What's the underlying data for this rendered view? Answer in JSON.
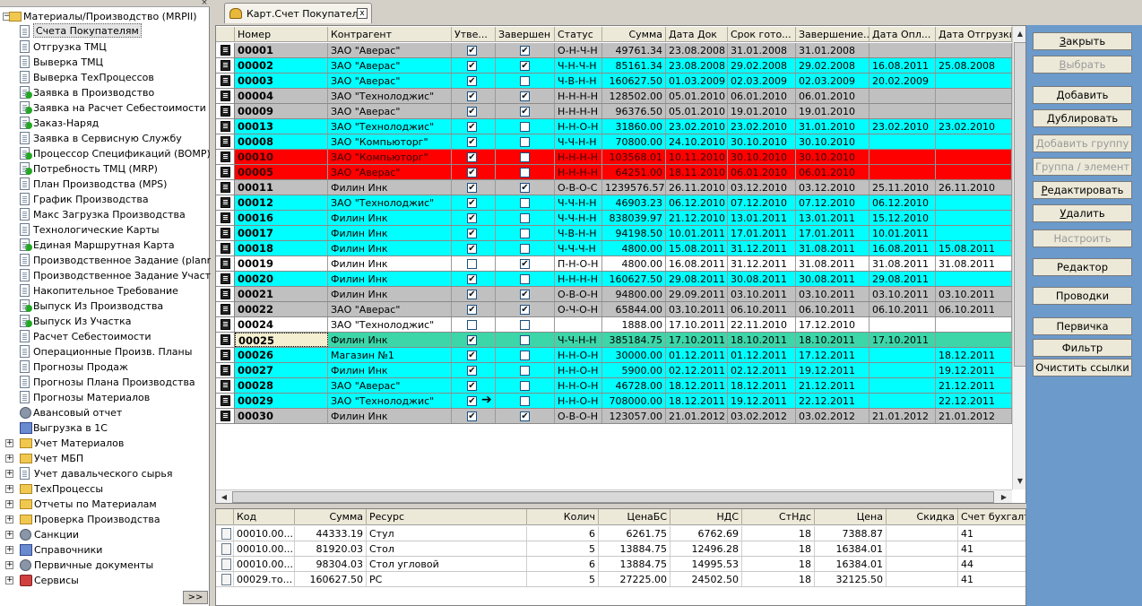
{
  "tree": {
    "root_label": "Материалы/Производство (MRPII)",
    "items": [
      {
        "label": "Счета Покупателям",
        "icon": "document-arrow-icon"
      },
      {
        "label": "Отгрузка ТМЦ",
        "icon": "document-arrow-icon"
      },
      {
        "label": "Выверка ТМЦ",
        "icon": "document-icon"
      },
      {
        "label": "Выверка ТехПроцессов",
        "icon": "document-icon"
      },
      {
        "label": "Заявка в Производство",
        "icon": "document-plus-icon"
      },
      {
        "label": "Заявка на Расчет Себестоимости",
        "icon": "document-plus-icon"
      },
      {
        "label": "Заказ-Наряд",
        "icon": "document-plus-icon"
      },
      {
        "label": "Заявка в Сервисную Службу",
        "icon": "document-arrow-icon"
      },
      {
        "label": "Процессор Спецификаций (BOMP)",
        "icon": "document-plus-icon"
      },
      {
        "label": "Потребность ТМЦ (MRP)",
        "icon": "document-plus-icon"
      },
      {
        "label": "План Производства (MPS)",
        "icon": "document-icon"
      },
      {
        "label": "График Производства",
        "icon": "document-arrow-icon"
      },
      {
        "label": "Макс Загрузка Производства",
        "icon": "document-arrow-icon"
      },
      {
        "label": "Технологические Карты",
        "icon": "document-arrow-icon"
      },
      {
        "label": "Единая Маршрутная Карта",
        "icon": "document-plus-icon"
      },
      {
        "label": "Производственное Задание (planne...",
        "icon": "document-arrow-icon"
      },
      {
        "label": "Производственное Задание Участка",
        "icon": "document-arrow-icon"
      },
      {
        "label": "Накопительное Требование",
        "icon": "document-arrow-icon"
      },
      {
        "label": "Выпуск Из Производства",
        "icon": "document-plus-icon"
      },
      {
        "label": "Выпуск Из Участка",
        "icon": "document-plus-icon"
      },
      {
        "label": "Расчет Себестоимости",
        "icon": "document-arrow-icon"
      },
      {
        "label": "Операционные Произв. Планы",
        "icon": "document-icon"
      },
      {
        "label": "Прогнозы Продаж",
        "icon": "document-arrow-icon"
      },
      {
        "label": "Прогнозы Плана Производства",
        "icon": "document-icon"
      },
      {
        "label": "Прогнозы Материалов",
        "icon": "document-arrow-icon"
      },
      {
        "label": "Авансовый отчет",
        "icon": "ledger-icon"
      },
      {
        "label": "Выгрузка в 1С",
        "icon": "export-icon"
      }
    ],
    "groups": [
      {
        "label": "Учет Материалов",
        "icon": "folder-icon"
      },
      {
        "label": "Учет МБП",
        "icon": "folder-icon"
      },
      {
        "label": "Учет давальческого сырья",
        "icon": "document-icon"
      },
      {
        "label": "ТехПроцессы",
        "icon": "folder-icon"
      },
      {
        "label": "Отчеты по Материалам",
        "icon": "folder-icon"
      },
      {
        "label": "Проверка Производства",
        "icon": "folder-icon"
      },
      {
        "label": "Санкции",
        "icon": "gear-icon"
      },
      {
        "label": "Справочники",
        "icon": "cube-icon"
      },
      {
        "label": "Первичные документы",
        "icon": "gear-icon"
      },
      {
        "label": "Сервисы",
        "icon": "tools-icon"
      }
    ],
    "more_label": ">>"
  },
  "tab": {
    "title": "Карт.Счет Покупателю",
    "close": "x"
  },
  "grid": {
    "columns": [
      "Номер",
      "Контрагент",
      "Утве...",
      "Завершен",
      "Статус",
      "Сумма",
      "Дата Док",
      "Срок гото...",
      "Завершение...",
      "Дата Опл...",
      "Дата Отгрузки"
    ],
    "rows": [
      {
        "num": "00001",
        "agent": "ЗАО \"Аверас\"",
        "appr": true,
        "done": true,
        "status": "О-Н-Ч-Н",
        "sum": "49761.34",
        "date": "23.08.2008",
        "term": "31.01.2008",
        "fin": "31.01.2008",
        "pay": "",
        "ship": "",
        "color": "#c0c0c0"
      },
      {
        "num": "00002",
        "agent": "ЗАО \"Аверас\"",
        "appr": true,
        "done": true,
        "status": "Ч-Н-Ч-Н",
        "sum": "85161.34",
        "date": "23.08.2008",
        "term": "29.02.2008",
        "fin": "29.02.2008",
        "pay": "16.08.2011",
        "ship": "25.08.2008",
        "color": "#00ffff"
      },
      {
        "num": "00003",
        "agent": "ЗАО \"Аверас\"",
        "appr": true,
        "done": false,
        "status": "Ч-В-Н-Н",
        "sum": "160627.50",
        "date": "01.03.2009",
        "term": "02.03.2009",
        "fin": "02.03.2009",
        "pay": "20.02.2009",
        "ship": "",
        "color": "#00ffff"
      },
      {
        "num": "00004",
        "agent": "ЗАО \"Технолоджис\"",
        "appr": true,
        "done": true,
        "status": "Н-Н-Н-Н",
        "sum": "128502.00",
        "date": "05.01.2010",
        "term": "06.01.2010",
        "fin": "06.01.2010",
        "pay": "",
        "ship": "",
        "color": "#c0c0c0"
      },
      {
        "num": "00009",
        "agent": "ЗАО \"Аверас\"",
        "appr": true,
        "done": true,
        "status": "Н-Н-Н-Н",
        "sum": "96376.50",
        "date": "05.01.2010",
        "term": "19.01.2010",
        "fin": "19.01.2010",
        "pay": "",
        "ship": "",
        "color": "#c0c0c0"
      },
      {
        "num": "00013",
        "agent": "ЗАО \"Технолоджис\"",
        "appr": true,
        "done": false,
        "status": "Н-Н-О-Н",
        "sum": "31860.00",
        "date": "23.02.2010",
        "term": "23.02.2010",
        "fin": "31.01.2010",
        "pay": "23.02.2010",
        "ship": "23.02.2010",
        "color": "#00ffff"
      },
      {
        "num": "00008",
        "agent": "ЗАО \"Компьюторг\"",
        "appr": true,
        "done": false,
        "status": "Ч-Ч-Н-Н",
        "sum": "70800.00",
        "date": "24.10.2010",
        "term": "30.10.2010",
        "fin": "30.10.2010",
        "pay": "",
        "ship": "",
        "color": "#00ffff"
      },
      {
        "num": "00010",
        "agent": "ЗАО \"Компьюторг\"",
        "appr": true,
        "done": false,
        "status": "Н-Н-Н-Н",
        "sum": "103568.01",
        "date": "10.11.2010",
        "term": "30.10.2010",
        "fin": "30.10.2010",
        "pay": "",
        "ship": "",
        "color": "#ff0000"
      },
      {
        "num": "00005",
        "agent": "ЗАО \"Аверас\"",
        "appr": true,
        "done": false,
        "status": "Н-Н-Н-Н",
        "sum": "64251.00",
        "date": "18.11.2010",
        "term": "06.01.2010",
        "fin": "06.01.2010",
        "pay": "",
        "ship": "",
        "color": "#ff0000"
      },
      {
        "num": "00011",
        "agent": "Филин Инк",
        "appr": true,
        "done": true,
        "status": "О-В-О-С",
        "sum": "1239576.57",
        "date": "26.11.2010",
        "term": "03.12.2010",
        "fin": "03.12.2010",
        "pay": "25.11.2010",
        "ship": "26.11.2010",
        "color": "#c0c0c0"
      },
      {
        "num": "00012",
        "agent": "ЗАО \"Технолоджис\"",
        "appr": true,
        "done": false,
        "status": "Ч-Ч-Н-Н",
        "sum": "46903.23",
        "date": "06.12.2010",
        "term": "07.12.2010",
        "fin": "07.12.2010",
        "pay": "06.12.2010",
        "ship": "",
        "color": "#00ffff"
      },
      {
        "num": "00016",
        "agent": "Филин Инк",
        "appr": true,
        "done": false,
        "status": "Ч-Ч-Н-Н",
        "sum": "838039.97",
        "date": "21.12.2010",
        "term": "13.01.2011",
        "fin": "13.01.2011",
        "pay": "15.12.2010",
        "ship": "",
        "color": "#00ffff"
      },
      {
        "num": "00017",
        "agent": "Филин Инк",
        "appr": true,
        "done": false,
        "status": "Ч-В-Н-Н",
        "sum": "94198.50",
        "date": "10.01.2011",
        "term": "17.01.2011",
        "fin": "17.01.2011",
        "pay": "10.01.2011",
        "ship": "",
        "color": "#00ffff"
      },
      {
        "num": "00018",
        "agent": "Филин Инк",
        "appr": true,
        "done": false,
        "status": "Ч-Ч-Ч-Н",
        "sum": "4800.00",
        "date": "15.08.2011",
        "term": "31.12.2011",
        "fin": "31.08.2011",
        "pay": "16.08.2011",
        "ship": "15.08.2011",
        "color": "#00ffff"
      },
      {
        "num": "00019",
        "agent": "Филин Инк",
        "appr": false,
        "done": true,
        "status": "П-Н-О-Н",
        "sum": "4800.00",
        "date": "16.08.2011",
        "term": "31.12.2011",
        "fin": "31.08.2011",
        "pay": "31.08.2011",
        "ship": "31.08.2011",
        "color": "#ffffff"
      },
      {
        "num": "00020",
        "agent": "Филин Инк",
        "appr": true,
        "done": false,
        "status": "Н-Н-Н-Н",
        "sum": "160627.50",
        "date": "29.08.2011",
        "term": "30.08.2011",
        "fin": "30.08.2011",
        "pay": "29.08.2011",
        "ship": "",
        "color": "#00ffff"
      },
      {
        "num": "00021",
        "agent": "Филин Инк",
        "appr": true,
        "done": true,
        "status": "О-В-О-Н",
        "sum": "94800.00",
        "date": "29.09.2011",
        "term": "03.10.2011",
        "fin": "03.10.2011",
        "pay": "03.10.2011",
        "ship": "03.10.2011",
        "color": "#c0c0c0"
      },
      {
        "num": "00022",
        "agent": "ЗАО \"Аверас\"",
        "appr": true,
        "done": true,
        "status": "О-Ч-О-Н",
        "sum": "65844.00",
        "date": "03.10.2011",
        "term": "06.10.2011",
        "fin": "06.10.2011",
        "pay": "06.10.2011",
        "ship": "06.10.2011",
        "color": "#c0c0c0"
      },
      {
        "num": "00024",
        "agent": "ЗАО \"Технолоджис\"",
        "appr": false,
        "done": false,
        "status": "",
        "sum": "1888.00",
        "date": "17.10.2011",
        "term": "22.11.2010",
        "fin": "17.12.2010",
        "pay": "",
        "ship": "",
        "color": "#ffffff"
      },
      {
        "num": "00025",
        "agent": "Филин Инк",
        "appr": true,
        "done": false,
        "status": "Ч-Ч-Н-Н",
        "sum": "385184.75",
        "date": "17.10.2011",
        "term": "18.10.2011",
        "fin": "18.10.2011",
        "pay": "17.10.2011",
        "ship": "",
        "color": "#3cd6a8",
        "current": true
      },
      {
        "num": "00026",
        "agent": "Магазин №1",
        "appr": true,
        "done": false,
        "status": "Н-Н-О-Н",
        "sum": "30000.00",
        "date": "01.12.2011",
        "term": "01.12.2011",
        "fin": "17.12.2011",
        "pay": "",
        "ship": "18.12.2011",
        "color": "#00ffff"
      },
      {
        "num": "00027",
        "agent": "Филин Инк",
        "appr": true,
        "done": false,
        "status": "Н-Н-О-Н",
        "sum": "5900.00",
        "date": "02.12.2011",
        "term": "02.12.2011",
        "fin": "19.12.2011",
        "pay": "",
        "ship": "19.12.2011",
        "color": "#00ffff"
      },
      {
        "num": "00028",
        "agent": "ЗАО \"Аверас\"",
        "appr": true,
        "done": false,
        "status": "Н-Н-О-Н",
        "sum": "46728.00",
        "date": "18.12.2011",
        "term": "18.12.2011",
        "fin": "21.12.2011",
        "pay": "",
        "ship": "21.12.2011",
        "color": "#00ffff"
      },
      {
        "num": "00029",
        "agent": "ЗАО \"Технолоджис\"",
        "appr": true,
        "done": false,
        "status": "Н-Н-О-Н",
        "sum": "708000.00",
        "date": "18.12.2011",
        "term": "19.12.2011",
        "fin": "22.12.2011",
        "pay": "",
        "ship": "22.12.2011",
        "color": "#00ffff",
        "arrow": true
      },
      {
        "num": "00030",
        "agent": "Филин Инк",
        "appr": true,
        "done": true,
        "status": "О-В-О-Н",
        "sum": "123057.00",
        "date": "21.01.2012",
        "term": "03.02.2012",
        "fin": "03.02.2012",
        "pay": "21.01.2012",
        "ship": "21.01.2012",
        "color": "#c0c0c0"
      }
    ]
  },
  "subgrid": {
    "columns": [
      "Код",
      "Сумма",
      "Ресурс",
      "Колич",
      "ЦенаБС",
      "НДС",
      "СтНдс",
      "Цена",
      "Скидка",
      "Счет бухгалте"
    ],
    "rows": [
      {
        "code": "00010.00...",
        "sum": "44333.19",
        "res": "Стул",
        "qty": "6",
        "pbs": "6261.75",
        "vat": "6762.69",
        "rate": "18",
        "price": "7388.87",
        "disc": "",
        "acc": "41"
      },
      {
        "code": "00010.00...",
        "sum": "81920.03",
        "res": "Стол",
        "qty": "5",
        "pbs": "13884.75",
        "vat": "12496.28",
        "rate": "18",
        "price": "16384.01",
        "disc": "",
        "acc": "41"
      },
      {
        "code": "00010.00...",
        "sum": "98304.03",
        "res": "Стол угловой",
        "qty": "6",
        "pbs": "13884.75",
        "vat": "14995.53",
        "rate": "18",
        "price": "16384.01",
        "disc": "",
        "acc": "44"
      },
      {
        "code": "00029.то...",
        "sum": "160627.50",
        "res": "РС",
        "qty": "5",
        "pbs": "27225.00",
        "vat": "24502.50",
        "rate": "18",
        "price": "32125.50",
        "disc": "",
        "acc": "41"
      }
    ]
  },
  "buttons": [
    {
      "label": "Закрыть",
      "ul": "З",
      "disabled": false
    },
    {
      "label": "Выбрать",
      "ul": "В",
      "disabled": true
    },
    {
      "label": "Добавить",
      "ul": "Д",
      "disabled": false
    },
    {
      "label": "Дублировать",
      "ul": "Д",
      "disabled": false
    },
    {
      "label": "Добавить группу",
      "ul": "",
      "disabled": true
    },
    {
      "label": "Группа / элемент",
      "ul": "",
      "disabled": true
    },
    {
      "label": "Редактировать",
      "ul": "Р",
      "disabled": false
    },
    {
      "label": "Удалить",
      "ul": "У",
      "disabled": false
    },
    {
      "label": "Настроить",
      "ul": "",
      "disabled": true
    },
    {
      "label": "Редактор",
      "ul": "",
      "disabled": false
    },
    {
      "label": "Проводки",
      "ul": "",
      "disabled": false
    },
    {
      "label": "Первичка",
      "ul": "",
      "disabled": false
    },
    {
      "label": "Фильтр",
      "ul": "",
      "disabled": false
    },
    {
      "label": "Очистить ссылки",
      "ul": "",
      "disabled": false
    }
  ],
  "colors": {
    "cyan": "#00ffff",
    "gray": "#c0c0c0",
    "red": "#ff0000",
    "current": "#3cd6a8",
    "panel_blue": "#6b9acb"
  }
}
